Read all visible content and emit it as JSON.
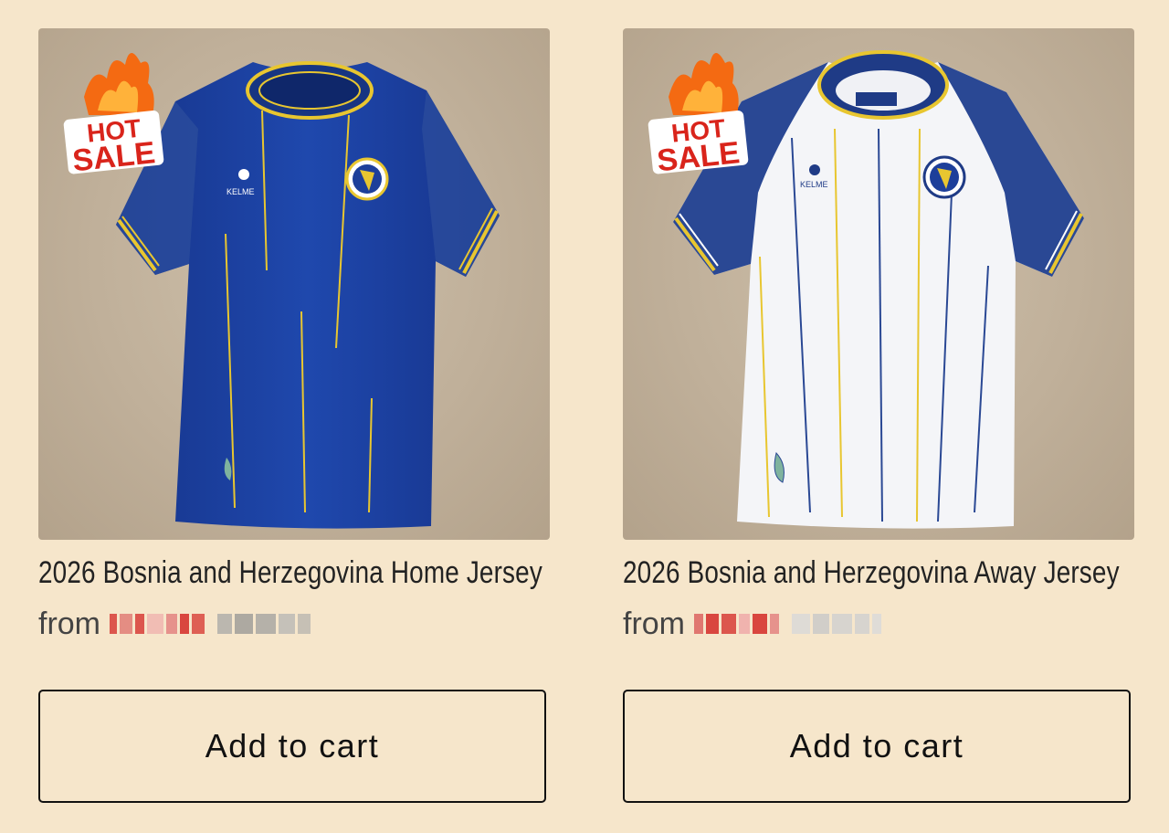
{
  "products": [
    {
      "title": "2026 Bosnia and Herzegovina Home Jersey",
      "from_label": "from",
      "badge_line1": "HOT",
      "badge_line2": "SALE",
      "brand_mark": "KELME",
      "cart_label": "Add to cart",
      "shirt_color": "#1d3f9a"
    },
    {
      "title": "2026 Bosnia and Herzegovina Away Jersey",
      "from_label": "from",
      "badge_line1": "HOT",
      "badge_line2": "SALE",
      "brand_mark": "KELME",
      "cart_label": "Add to cart",
      "shirt_color": "#f4f5f8"
    }
  ],
  "colors": {
    "background": "#f6e6cb",
    "price_redacted": "#d9463f",
    "compare_redacted": "#9a9a9a",
    "accent_yellow": "#e8c630"
  }
}
